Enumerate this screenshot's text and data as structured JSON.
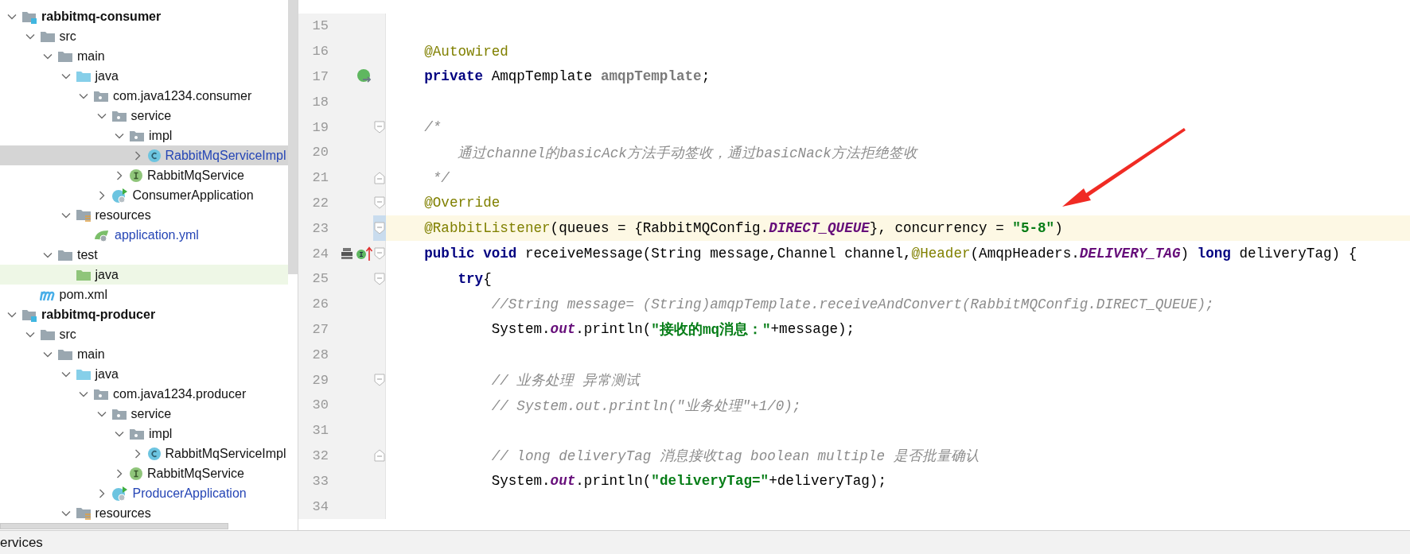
{
  "project_tree": [
    {
      "name": "rabbitmq-consumer",
      "kind": "module",
      "expanded": true,
      "selected": false,
      "modified": false,
      "children": [
        {
          "name": "src",
          "kind": "folder",
          "expanded": true,
          "selected": false,
          "modified": false,
          "children": [
            {
              "name": "main",
              "kind": "folder",
              "expanded": true,
              "selected": false,
              "modified": false,
              "children": [
                {
                  "name": "java",
                  "kind": "source",
                  "expanded": true,
                  "selected": false,
                  "modified": false,
                  "children": [
                    {
                      "name": "com.java1234.consumer",
                      "kind": "package",
                      "expanded": true,
                      "selected": false,
                      "modified": false,
                      "children": [
                        {
                          "name": "service",
                          "kind": "package",
                          "expanded": true,
                          "selected": false,
                          "modified": false,
                          "children": [
                            {
                              "name": "impl",
                              "kind": "package",
                              "expanded": true,
                              "selected": false,
                              "modified": false,
                              "children": [
                                {
                                  "name": "RabbitMqServiceImpl",
                                  "kind": "class",
                                  "expanded": false,
                                  "selected": true,
                                  "modified": true
                                }
                              ]
                            },
                            {
                              "name": "RabbitMqService",
                              "kind": "interface",
                              "expanded": false,
                              "selected": false,
                              "modified": false
                            }
                          ]
                        },
                        {
                          "name": "ConsumerApplication",
                          "kind": "app",
                          "expanded": false,
                          "selected": false,
                          "modified": false
                        }
                      ]
                    }
                  ]
                },
                {
                  "name": "resources",
                  "kind": "resources",
                  "expanded": true,
                  "selected": false,
                  "modified": false,
                  "children": [
                    {
                      "name": "application.yml",
                      "kind": "yml",
                      "selected": false,
                      "modified": true
                    }
                  ]
                }
              ]
            },
            {
              "name": "test",
              "kind": "folder",
              "expanded": true,
              "selected": false,
              "modified": false,
              "children": [
                {
                  "name": "java",
                  "kind": "test_source",
                  "selected": false,
                  "modified": false
                }
              ]
            }
          ]
        },
        {
          "name": "pom.xml",
          "kind": "maven",
          "selected": false,
          "modified": false
        }
      ]
    },
    {
      "name": "rabbitmq-producer",
      "kind": "module",
      "expanded": true,
      "selected": false,
      "modified": false,
      "children": [
        {
          "name": "src",
          "kind": "folder",
          "expanded": true,
          "selected": false,
          "modified": false,
          "children": [
            {
              "name": "main",
              "kind": "folder",
              "expanded": true,
              "selected": false,
              "modified": false,
              "children": [
                {
                  "name": "java",
                  "kind": "source",
                  "expanded": true,
                  "selected": false,
                  "modified": false,
                  "children": [
                    {
                      "name": "com.java1234.producer",
                      "kind": "package",
                      "expanded": true,
                      "selected": false,
                      "modified": false,
                      "children": [
                        {
                          "name": "service",
                          "kind": "package",
                          "expanded": true,
                          "selected": false,
                          "modified": false,
                          "children": [
                            {
                              "name": "impl",
                              "kind": "package",
                              "expanded": true,
                              "selected": false,
                              "modified": false,
                              "children": [
                                {
                                  "name": "RabbitMqServiceImpl",
                                  "kind": "class",
                                  "expanded": false,
                                  "selected": false,
                                  "modified": false
                                }
                              ]
                            },
                            {
                              "name": "RabbitMqService",
                              "kind": "interface",
                              "expanded": false,
                              "selected": false,
                              "modified": false
                            }
                          ]
                        },
                        {
                          "name": "ProducerApplication",
                          "kind": "app",
                          "expanded": false,
                          "selected": false,
                          "modified": true
                        }
                      ]
                    }
                  ]
                },
                {
                  "name": "resources",
                  "kind": "resources",
                  "expanded": true,
                  "selected": false,
                  "modified": false
                }
              ]
            }
          ]
        }
      ]
    }
  ],
  "editor": {
    "lines": [
      {
        "number": "15",
        "current": false
      },
      {
        "number": "16",
        "current": false,
        "tokens": [
          {
            "kind": "ann",
            "text": "    @Autowired"
          }
        ]
      },
      {
        "number": "17",
        "current": false,
        "gutter_icons": [
          {
            "kind": "autowired"
          }
        ],
        "tokens": [
          {
            "kind": "kw",
            "text": "    private"
          },
          {
            "kind": "plain",
            "text": " AmqpTemplate "
          },
          {
            "kind": "unused",
            "text": "amqpTemplate"
          },
          {
            "kind": "plain",
            "text": ";"
          }
        ]
      },
      {
        "number": "18",
        "current": false
      },
      {
        "number": "19",
        "current": false,
        "fold_marker": {
          "kind": "start"
        },
        "tokens": [
          {
            "kind": "comment",
            "text": "    /*"
          }
        ]
      },
      {
        "number": "20",
        "current": false,
        "tokens": [
          {
            "kind": "comment",
            "text": "        通过channel的basicAck方法手动签收，通过basicNack方法拒绝签收"
          }
        ]
      },
      {
        "number": "21",
        "current": false,
        "fold_marker": {
          "kind": "end"
        },
        "tokens": [
          {
            "kind": "comment",
            "text": "     */"
          }
        ]
      },
      {
        "number": "22",
        "current": false,
        "fold_marker": {
          "kind": "start"
        },
        "tokens": [
          {
            "kind": "ann",
            "text": "    @Override"
          }
        ]
      },
      {
        "number": "23",
        "current": true,
        "fold_marker": {
          "kind": "start"
        },
        "tokens": [
          {
            "kind": "ann",
            "text": "    @RabbitListener"
          },
          {
            "kind": "plain",
            "text": "(queues = {RabbitMQConfig."
          },
          {
            "kind": "static",
            "text": "DIRECT_QUEUE"
          },
          {
            "kind": "plain",
            "text": "}, concurrency = "
          },
          {
            "kind": "str",
            "text": "\"5-8\""
          },
          {
            "kind": "plain",
            "text": ")"
          }
        ]
      },
      {
        "number": "24",
        "current": false,
        "fold_marker": {
          "kind": "start"
        },
        "gutter_icons": [
          {
            "kind": "listener"
          },
          {
            "kind": "implemented"
          }
        ],
        "tokens": [
          {
            "kind": "kw",
            "text": "    public void"
          },
          {
            "kind": "plain",
            "text": " receiveMessage(String message,Channel channel,"
          },
          {
            "kind": "ann",
            "text": "@Header"
          },
          {
            "kind": "plain",
            "text": "(AmqpHeaders."
          },
          {
            "kind": "static",
            "text": "DELIVERY_TAG"
          },
          {
            "kind": "plain",
            "text": ") "
          },
          {
            "kind": "kw",
            "text": "long"
          },
          {
            "kind": "plain",
            "text": " deliveryTag) {"
          }
        ]
      },
      {
        "number": "25",
        "current": false,
        "fold_marker": {
          "kind": "start"
        },
        "tokens": [
          {
            "kind": "kw",
            "text": "        try"
          },
          {
            "kind": "plain",
            "text": "{"
          }
        ]
      },
      {
        "number": "26",
        "current": false,
        "tokens": [
          {
            "kind": "comment",
            "text": "            //String message= (String)amqpTemplate.receiveAndConvert(RabbitMQConfig.DIRECT_QUEUE);"
          }
        ]
      },
      {
        "number": "27",
        "current": false,
        "tokens": [
          {
            "kind": "plain",
            "text": "            System."
          },
          {
            "kind": "static",
            "text": "out"
          },
          {
            "kind": "plain",
            "text": ".println("
          },
          {
            "kind": "str",
            "text": "\"接收的mq消息：\""
          },
          {
            "kind": "plain",
            "text": "+message);"
          }
        ]
      },
      {
        "number": "28",
        "current": false
      },
      {
        "number": "29",
        "current": false,
        "fold_marker": {
          "kind": "start"
        },
        "tokens": [
          {
            "kind": "comment",
            "text": "            // 业务处理 异常测试"
          }
        ]
      },
      {
        "number": "30",
        "current": false,
        "tokens": [
          {
            "kind": "comment",
            "text": "            // System.out.println(\"业务处理\"+1/0);"
          }
        ]
      },
      {
        "number": "31",
        "current": false
      },
      {
        "number": "32",
        "current": false,
        "fold_marker": {
          "kind": "end"
        },
        "tokens": [
          {
            "kind": "comment",
            "text": "            // long deliveryTag 消息接收tag boolean multiple 是否批量确认"
          }
        ]
      },
      {
        "number": "33",
        "current": false,
        "tokens": [
          {
            "kind": "plain",
            "text": "            System."
          },
          {
            "kind": "static",
            "text": "out"
          },
          {
            "kind": "plain",
            "text": ".println("
          },
          {
            "kind": "str",
            "text": "\"deliveryTag=\""
          },
          {
            "kind": "plain",
            "text": "+deliveryTag);"
          }
        ]
      },
      {
        "number": "34",
        "current": false
      }
    ]
  },
  "status_bar": {
    "tool_window": "ervices"
  }
}
